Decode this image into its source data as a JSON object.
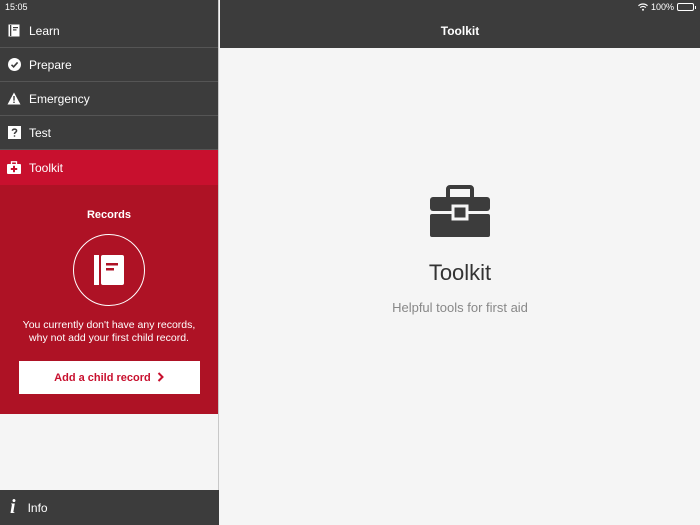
{
  "status": {
    "time": "15:05",
    "battery": "100%"
  },
  "sidebar": {
    "items": [
      {
        "label": "Learn",
        "icon": "book-icon"
      },
      {
        "label": "Prepare",
        "icon": "checkmark-circle-icon"
      },
      {
        "label": "Emergency",
        "icon": "warning-triangle-icon"
      },
      {
        "label": "Test",
        "icon": "question-box-icon"
      },
      {
        "label": "Toolkit",
        "icon": "medical-kit-icon",
        "active": true
      }
    ],
    "records": {
      "title": "Records",
      "icon": "record-book-icon",
      "message": "You currently don't have any records, why not add your first child record.",
      "button_label": "Add a child record"
    },
    "info_label": "Info"
  },
  "main": {
    "header_title": "Toolkit",
    "icon": "toolbox-icon",
    "title": "Toolkit",
    "subtitle": "Helpful tools for first aid"
  },
  "colors": {
    "dark_bar": "#3c3c3c",
    "accent_red": "#c8102e",
    "records_red": "#ae1225",
    "background": "#f5f5f5"
  }
}
